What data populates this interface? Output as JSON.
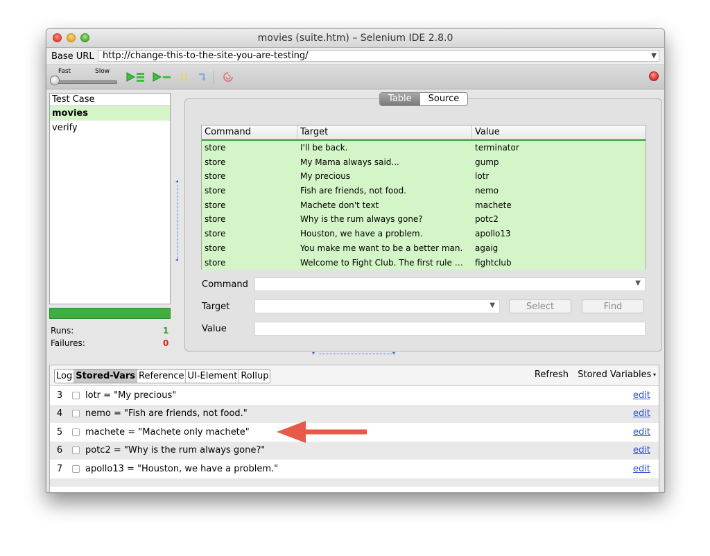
{
  "window": {
    "title": "movies (suite.htm) – Selenium IDE 2.8.0"
  },
  "url_bar": {
    "label": "Base URL",
    "value": "http://change-this-to-the-site-you-are-testing/"
  },
  "toolbar": {
    "speed_fast": "Fast",
    "speed_slow": "Slow",
    "speed_level": 0.0
  },
  "test_cases": {
    "header": "Test Case",
    "items": [
      {
        "label": "movies",
        "selected": true
      },
      {
        "label": "verify",
        "selected": false
      }
    ]
  },
  "stats": {
    "runs_label": "Runs:",
    "runs_value": "1",
    "failures_label": "Failures:",
    "failures_value": "0"
  },
  "editor_tabs": {
    "table": "Table",
    "source": "Source",
    "active": "Table"
  },
  "commands_table": {
    "headers": [
      "Command",
      "Target",
      "Value"
    ],
    "rows": [
      [
        "store",
        "I'll be back.",
        "terminator"
      ],
      [
        "store",
        "My Mama always said...",
        "gump"
      ],
      [
        "store",
        "My precious",
        "lotr"
      ],
      [
        "store",
        "Fish are friends, not food.",
        "nemo"
      ],
      [
        "store",
        "Machete don't text",
        "machete"
      ],
      [
        "store",
        "Why is the rum always gone?",
        "potc2"
      ],
      [
        "store",
        "Houston, we have a problem.",
        "apollo13"
      ],
      [
        "store",
        "You make me want to be a better man.",
        "agaig"
      ],
      [
        "store",
        "Welcome to Fight Club. The first rule …",
        "fightclub"
      ]
    ]
  },
  "form": {
    "command_label": "Command",
    "target_label": "Target",
    "value_label": "Value",
    "select_button": "Select",
    "find_button": "Find"
  },
  "bottom_tabs": {
    "items": [
      "Log",
      "Stored-Vars",
      "Reference",
      "UI-Element",
      "Rollup"
    ],
    "active": "Stored-Vars",
    "refresh": "Refresh",
    "stored_variables": "Stored Variables"
  },
  "stored_vars": [
    {
      "num": "3",
      "text": "lotr = \"My precious\"",
      "edit": "edit"
    },
    {
      "num": "4",
      "text": "nemo = \"Fish are friends, not food.\"",
      "edit": "edit"
    },
    {
      "num": "5",
      "text": "machete = \"Machete only machete\"",
      "edit": "edit"
    },
    {
      "num": "6",
      "text": "potc2 = \"Why is the rum always gone?\"",
      "edit": "edit"
    },
    {
      "num": "7",
      "text": "apollo13 = \"Houston, we have a problem.\"",
      "edit": "edit"
    }
  ],
  "colors": {
    "pass_green": "#d4f5c8",
    "progress_green": "#3fae3f",
    "annotation_arrow": "#e8594a",
    "link_blue": "#2a4fd6"
  }
}
